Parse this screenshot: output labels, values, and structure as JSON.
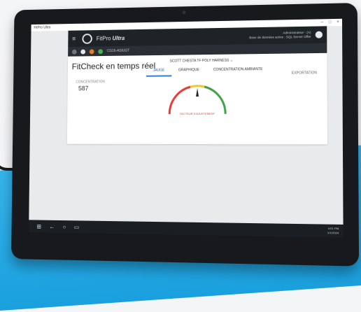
{
  "window": {
    "title": "FitPro Ultra",
    "controls": [
      "–",
      "□",
      "×"
    ]
  },
  "appbar": {
    "brand": "FitPro",
    "brand_suffix": "Ultra",
    "user_name": "Administrateur - (A)",
    "user_db": "Base de données active : SQL Server Offer"
  },
  "toolbar": {
    "instrument_label": "CG16-ASIUGT"
  },
  "page": {
    "title": "FitCheck en temps réel",
    "model_select": "SCOTT CHESTA TF POLY HARNESS ⌄",
    "tabs": [
      "JAUGE",
      "GRAPHIQUE",
      "CONCENTRATION AMBIANTE"
    ],
    "export_label": "EXPORTATION",
    "concentration_label": "CONCENTRATION",
    "concentration_value": "587",
    "gauge_caption": "FACTEUR D'AJUSTEMENT"
  },
  "taskbar": {
    "time": "4:01 PM",
    "date": "1/1/2024"
  },
  "colors": {
    "gauge_red": "#e53935",
    "gauge_yellow": "#f4c430",
    "gauge_green": "#43a047",
    "tab_active": "#2a7fd4"
  }
}
